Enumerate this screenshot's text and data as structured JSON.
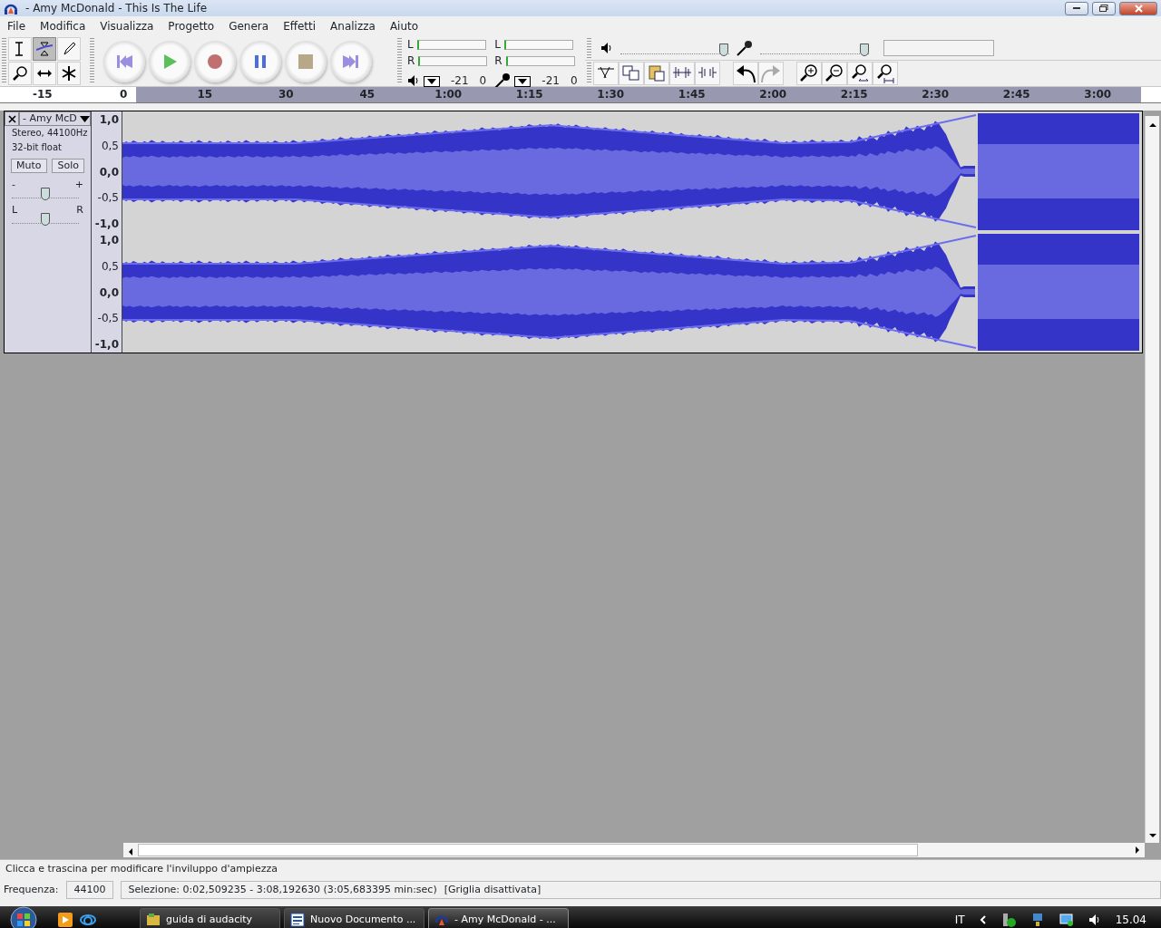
{
  "window": {
    "title": "- Amy McDonald - This Is The Life"
  },
  "menu": [
    "File",
    "Modifica",
    "Visualizza",
    "Progetto",
    "Genera",
    "Effetti",
    "Analizza",
    "Aiuto"
  ],
  "tools": [
    {
      "kind": "select",
      "selected": false
    },
    {
      "kind": "envelope",
      "selected": true
    },
    {
      "kind": "draw",
      "selected": false
    },
    {
      "kind": "zoom",
      "selected": false
    },
    {
      "kind": "timeshift",
      "selected": false
    },
    {
      "kind": "multi",
      "selected": false
    }
  ],
  "transport": [
    {
      "kind": "start"
    },
    {
      "kind": "play"
    },
    {
      "kind": "record"
    },
    {
      "kind": "pause"
    },
    {
      "kind": "stop"
    },
    {
      "kind": "end"
    }
  ],
  "meters": [
    {
      "kind": "output",
      "channels": [
        "L",
        "R"
      ],
      "ticks": [
        "-21",
        "0"
      ]
    },
    {
      "kind": "input",
      "channels": [
        "L",
        "R"
      ],
      "ticks": [
        "-21",
        "0"
      ]
    }
  ],
  "mixer": [
    {
      "kind": "output",
      "level": 0.95
    },
    {
      "kind": "input",
      "level": 0.96
    }
  ],
  "edit_tools": [
    {
      "kind": "trim"
    },
    {
      "kind": "copy"
    },
    {
      "kind": "paste"
    },
    {
      "kind": "silence"
    },
    {
      "kind": "trimaudio"
    },
    {
      "kind": "undo"
    },
    {
      "kind": "redo"
    },
    {
      "kind": "zoomin"
    },
    {
      "kind": "zoomout"
    },
    {
      "kind": "fitsel"
    },
    {
      "kind": "fit"
    }
  ],
  "ruler": {
    "ticks": [
      "-15",
      "0",
      "15",
      "30",
      "45",
      "1:00",
      "1:15",
      "1:30",
      "1:45",
      "2:00",
      "2:15",
      "2:30",
      "2:45",
      "3:00"
    ]
  },
  "track": {
    "name": "- Amy McD",
    "info": [
      "Stereo, 44100Hz",
      "32-bit float"
    ],
    "buttons": [
      "Muto",
      "Solo"
    ],
    "gain": {
      "min": "-",
      "max": "+",
      "level": 0.5
    },
    "pan": {
      "min": "L",
      "max": "R",
      "level": 0.5
    },
    "channels": [
      {
        "scale": [
          {
            "text": "1,0",
            "major": true
          },
          {
            "text": "0,5",
            "major": false
          },
          {
            "text": "0,0",
            "major": true
          },
          {
            "text": "-0,5",
            "major": false
          },
          {
            "text": "-1,0",
            "major": true
          }
        ]
      },
      {
        "scale": [
          {
            "text": "1,0",
            "major": true
          },
          {
            "text": "0,5",
            "major": false
          },
          {
            "text": "0,0",
            "major": true
          },
          {
            "text": "-0,5",
            "major": false
          },
          {
            "text": "-1,0",
            "major": true
          }
        ]
      }
    ]
  },
  "status": {
    "message": "Clicca e trascina per modificare l'inviluppo d'ampiezza",
    "rate_label": "Frequenza:",
    "rate": "44100",
    "selection": "Selezione: 0:02,509235 - 3:08,192630 (3:05,683395 min:sec)",
    "grid": "[Griglia disattivata]"
  },
  "taskbar": {
    "tasks": [
      {
        "kind": "folder",
        "label": "guida di audacity",
        "selected": false
      },
      {
        "kind": "word",
        "label": "Nuovo Documento ...",
        "selected": false
      },
      {
        "kind": "audacity",
        "label": "- Amy McDonald - ...",
        "selected": true
      }
    ],
    "language": "IT",
    "clock": "15.04"
  }
}
